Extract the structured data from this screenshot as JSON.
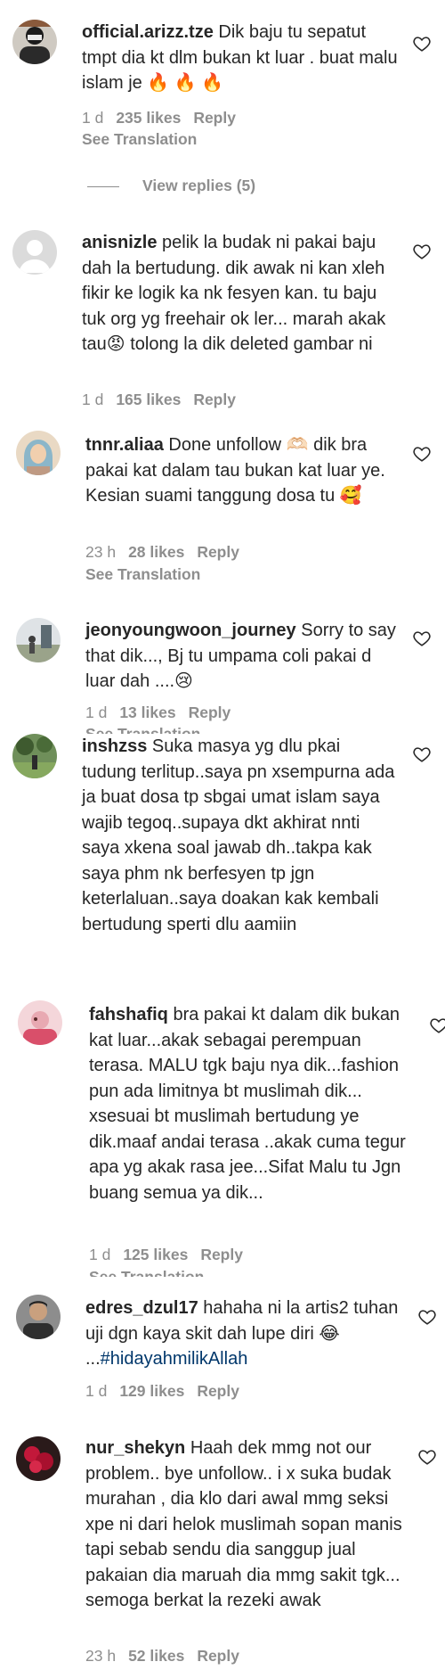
{
  "view_replies_label": "View replies (5)",
  "comments": [
    {
      "username": "official.arizz.tze",
      "text": "Dik baju tu sepatut tmpt dia kt dlm bukan kt luar . buat malu islam je 🔥 🔥 🔥",
      "time": "1 d",
      "likes": "235 likes",
      "reply": "Reply",
      "see_translation": "See Translation"
    },
    {
      "username": "anisnizle",
      "text": "pelik la budak ni pakai baju dah la bertudung. dik awak ni kan xleh fikir ke logik ka nk fesyen kan. tu baju tuk org yg freehair ok ler... marah akak tau😡 tolong la dik deleted gambar ni",
      "time": "1 d",
      "likes": "165 likes",
      "reply": "Reply"
    },
    {
      "username": "tnnr.aliaa",
      "text": "Done unfollow 🫶🏻 dik bra pakai kat dalam tau bukan kat luar ye. Kesian suami tanggung dosa tu 🥰",
      "time": "23 h",
      "likes": "28 likes",
      "reply": "Reply",
      "see_translation": "See Translation"
    },
    {
      "username": "jeonyoungwoon_journey",
      "text": "Sorry to say that dik..., Bj tu umpama coli pakai d luar dah ....😢",
      "time": "1 d",
      "likes": "13 likes",
      "reply": "Reply",
      "see_translation": "See Translation"
    },
    {
      "username": "inshzss",
      "text": "Suka masya yg dlu pkai tudung terlitup..saya pn xsempurna ada ja buat dosa tp sbgai umat islam saya wajib tegoq..supaya dkt akhirat nnti saya xkena soal jawab dh..takpa kak saya phm nk berfesyen tp jgn keterlaluan..saya doakan kak kembali bertudung sperti dlu aamiin"
    },
    {
      "username": "fahshafiq",
      "text": "bra pakai kt dalam dik bukan kat luar...akak sebagai perempuan terasa. MALU tgk baju nya dik...fashion pun ada limitnya bt muslimah dik... xsesuai bt muslimah bertudung ye dik.maaf andai terasa ..akak cuma tegur apa yg akak rasa jee...Sifat Malu tu Jgn buang semua ya dik...",
      "time": "1 d",
      "likes": "125 likes",
      "reply": "Reply",
      "see_translation": "See Translation"
    },
    {
      "username": "edres_dzul17",
      "text": "hahaha ni la artis2 tuhan uji dgn kaya skit dah lupe diri 😂 ...",
      "hashtag": "#hidayahmilikAllah",
      "time": "1 d",
      "likes": "129 likes",
      "reply": "Reply"
    },
    {
      "username": "nur_shekyn",
      "text": "Haah dek mmg not our problem.. bye unfollow.. i x suka budak murahan , dia klo dari awal mmg seksi xpe ni dari helok muslimah sopan manis tapi sebab sendu dia sanggup jual pakaian dia maruah dia mmg sakit tgk... semoga berkat la rezeki awak",
      "time": "23 h",
      "likes": "52 likes",
      "reply": "Reply"
    }
  ]
}
